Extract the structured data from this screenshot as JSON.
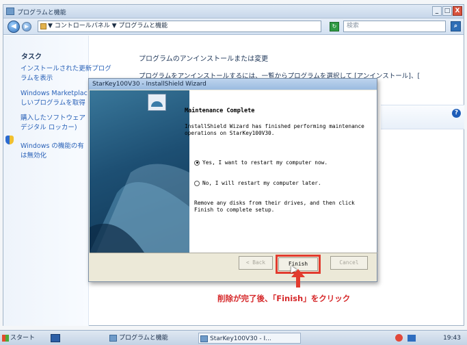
{
  "window": {
    "title": "プログラムと機能",
    "buttons": {
      "minimize": "_",
      "maximize": "□",
      "close": "X"
    }
  },
  "address_bar": {
    "path": "▼ コントロールパネル ▼ プログラムと機能",
    "back": "◀",
    "forward": "▶",
    "search_placeholder": "検索"
  },
  "sidebar": {
    "task_heading": "タスク",
    "links": [
      "インストールされた更新プログラムを表示",
      "Windows Marketplac しいプログラムを取得",
      "購入したソフトウェア デジタル ロッカー)",
      "Windows の機能の有 は無効化"
    ]
  },
  "main": {
    "title": "プログラムのアンインストールまたは変更",
    "description": "プログラムをアンインストールするには、一覧からプログラムを選択して [アンインストール]、["
  },
  "dialog": {
    "title": "StarKey100V30 - InstallShield Wizard",
    "heading": "Maintenance Complete",
    "message": "InstallShield Wizard has finished performing maintenance operations on StarKey100V30.",
    "options": [
      {
        "label": "Yes, I want to restart my computer now.",
        "selected": true
      },
      {
        "label": "No, I will restart my computer later.",
        "selected": false
      }
    ],
    "remove_text": "Remove any disks from their drives, and then click Finish to complete setup.",
    "buttons": {
      "back": "< Back",
      "finish": "Finish",
      "cancel": "Cancel"
    }
  },
  "annotation": {
    "callout": "削除が完了後、「Finish」をクリック",
    "color": "#e23b2e"
  },
  "taskbar": {
    "start": "スタート",
    "tasks": [
      "プログラムと機能",
      "StarKey100V30 - I..."
    ],
    "clock": "19:43"
  }
}
